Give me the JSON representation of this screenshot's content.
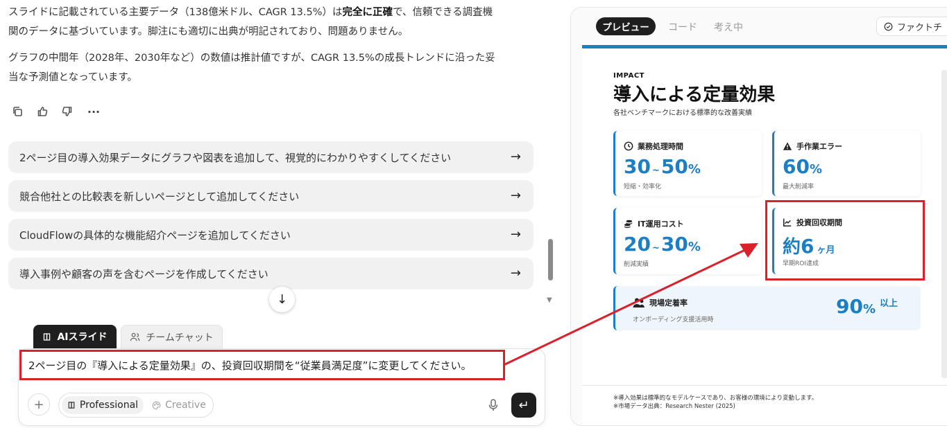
{
  "chat": {
    "para1_a": "スライドに記載されている主要データ（138億米ドル、CAGR 13.5%）は",
    "para1_bold": "完全に正確",
    "para1_b": "で、信頼できる調査機",
    "para1_line2": "関のデータに基づいています。脚注にも適切に出典が明記されており、問題ありません。",
    "para2_line1": "グラフの中間年（2028年、2030年など）の数値は推計値ですが、CAGR 13.5%の成長トレンドに沿った妥",
    "para2_line2": "当な予測値となっています。",
    "actions": [
      "copy-icon",
      "thumbs-up-icon",
      "thumbs-down-icon",
      "more-icon"
    ],
    "more_glyph": "···",
    "suggestions": [
      "2ページ目の導入効果データにグラフや図表を追加して、視覚的にわかりやすくしてください",
      "競合他社との比較表を新しいページとして追加してください",
      "CloudFlowの具体的な機能紹介ページを追加してください",
      "導入事例や顧客の声を含むページを作成してください"
    ],
    "arrow_glyph": "→",
    "down_glyph": "↓",
    "scroll_down_glyph": "▼"
  },
  "composer": {
    "tab_ai": "AIスライド",
    "tab_team": "チームチャット",
    "prompt": "2ページ目の『導入による定量効果』の、投資回収期間を“従業員満足度”に変更してください。",
    "plus": "+",
    "mode_professional": "Professional",
    "mode_creative": "Creative",
    "send_glyph": "↵"
  },
  "preview": {
    "tab_preview": "プレビュー",
    "tab_code": "コード",
    "tab_thinking": "考え中",
    "factcheck": "ファクトチ"
  },
  "slide": {
    "impact_label": "IMPACT",
    "title": "導入による定量効果",
    "subtitle": "各社ベンチマークにおける標準的な改善実績",
    "cards": {
      "c1": {
        "label": "業務処理時間",
        "val_a": "30",
        "val_sep": "~",
        "val_b": "50",
        "unit": "%",
        "note": "短縮・効率化"
      },
      "c2": {
        "label": "手作業エラー",
        "val_a": "60",
        "unit": "%",
        "note": "最大削減率"
      },
      "c3": {
        "label": "IT運用コスト",
        "val_a": "20",
        "val_sep": "~",
        "val_b": "30",
        "unit": "%",
        "note": "削減実績"
      },
      "c4": {
        "label": "投資回収期間",
        "val_prefix": "約",
        "val_a": "6",
        "unit": "ヶ月",
        "note": "早期ROI達成"
      },
      "c5": {
        "label": "現場定着率",
        "note": "オンボーディング支援活用時",
        "val_a": "90",
        "unit": "%",
        "suffix": "以上"
      }
    },
    "footnote1": "※導入効果は標準的なモデルケースであり、お客様の環境により変動します。",
    "footnote2": "※市場データ出典：Research Nester (2025)"
  },
  "colors": {
    "accent": "#1c7fc4",
    "highlight": "#d9202b",
    "dark": "#1f1f1f"
  }
}
